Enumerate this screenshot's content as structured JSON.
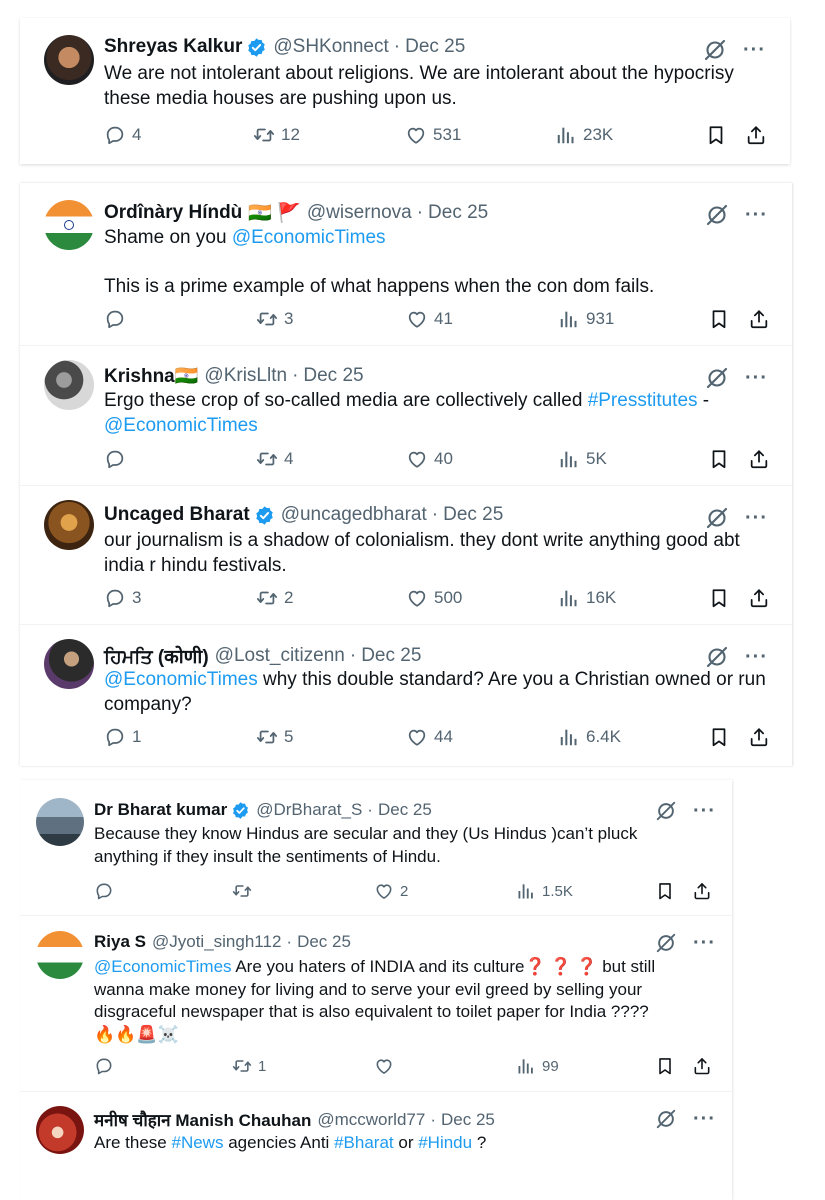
{
  "tweets": [
    {
      "name": "Shreyas Kalkur",
      "handle": "@SHKonnect",
      "date": "Dec 25",
      "text": "We are not intolerant about religions. We are intolerant about the hypocrisy these media houses are pushing upon us.",
      "replies": "4",
      "retweets": "12",
      "likes": "531",
      "views": "23K"
    },
    {
      "name": "Ordînàry Híndù",
      "flags": "🇮🇳 🚩",
      "handle": "@wisernova",
      "date": "Dec 25",
      "mention": "@EconomicTimes",
      "text_pre": "Shame on you",
      "text_post": "This is a prime example of what happens when the con dom fails.",
      "replies": "",
      "retweets": "3",
      "likes": "41",
      "views": "931"
    },
    {
      "name": "Krishna🇮🇳",
      "handle": "@KrisLltn",
      "date": "Dec 25",
      "text_pre": "Ergo these crop of so-called media are collectively called",
      "hashtag": "#Presstitutes",
      "text_mid": "-",
      "mention": "@EconomicTimes",
      "replies": "",
      "retweets": "4",
      "likes": "40",
      "views": "5K"
    },
    {
      "name": "Uncaged Bharat",
      "handle": "@uncagedbharat",
      "date": "Dec 25",
      "text": "our journalism is a shadow of colonialism. they dont write anything good abt india r hindu festivals.",
      "replies": "3",
      "retweets": "2",
      "likes": "500",
      "views": "16K"
    },
    {
      "name": "ਹਿਮਤਿ (कोणी)",
      "handle": "@Lost_citizenn",
      "date": "Dec 25",
      "mention": "@EconomicTimes",
      "text": "why this double standard? Are you a Christian owned or run company?",
      "replies": "1",
      "retweets": "5",
      "likes": "44",
      "views": "6.4K"
    },
    {
      "name": "Dr Bharat kumar",
      "handle": "@DrBharat_S",
      "date": "Dec 25",
      "text": "Because they know Hindus are secular and they (Us Hindus )can’t pluck anything if they insult the sentiments of Hindu.",
      "replies": "",
      "retweets": "",
      "likes": "2",
      "views": "1.5K"
    },
    {
      "name": "Riya S",
      "handle": "@Jyoti_singh112",
      "date": "Dec 25",
      "mention": "@EconomicTimes",
      "text_a": "Are you haters of INDIA and its culture",
      "qmarks": "❓ ❓ ❓",
      "text_b": "but still wanna make money for living and to serve your evil greed by selling your disgraceful newspaper that is also equivalent to toilet paper for India ????",
      "emojis": "🔥🔥🚨☠️",
      "replies": "",
      "retweets": "1",
      "likes": "",
      "views": "99"
    },
    {
      "name": "मनीष चौहान Manish Chauhan",
      "handle": "@mccworld77",
      "date": "Dec 25",
      "text_a": "Are these",
      "tag1": "#News",
      "text_b": "agencies Anti",
      "tag2": "#Bharat",
      "text_c": "or",
      "tag3": "#Hindu",
      "text_d": "?"
    }
  ],
  "icons": {
    "reply": "reply-icon",
    "retweet": "retweet-icon",
    "like": "heart-icon",
    "views": "views-icon",
    "bookmark": "bookmark-icon",
    "share": "share-icon",
    "grok": "grok-icon",
    "more": "more-icon",
    "verified": "verified-badge-icon"
  },
  "colors": {
    "link": "#1d9bf0",
    "muted": "#536471",
    "verified": "#1d9bf0"
  }
}
